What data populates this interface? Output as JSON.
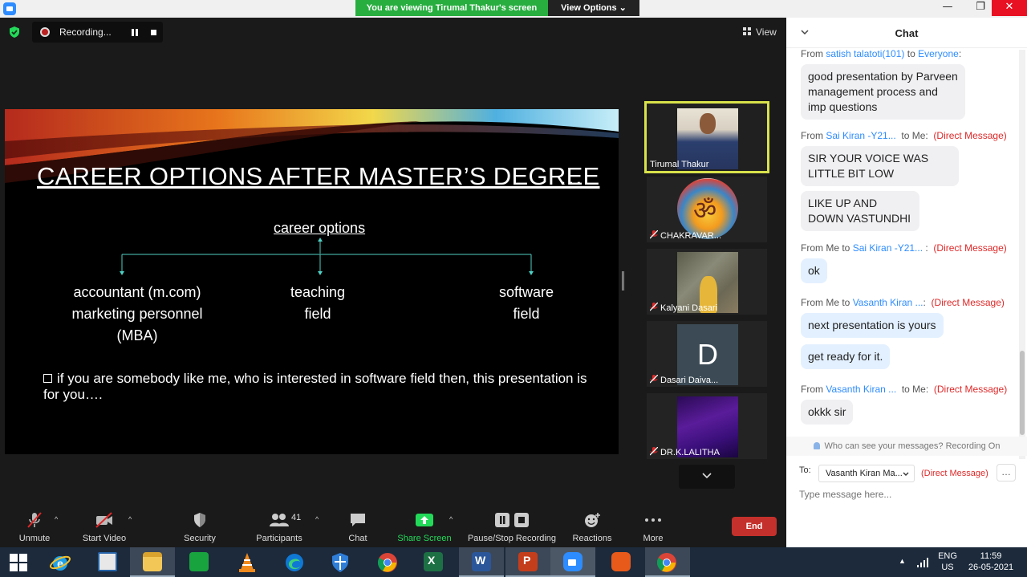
{
  "titlebar": {
    "viewing_banner": "You are viewing Tirumal Thakur's screen",
    "view_options": "View Options ⌄",
    "minimize": "—",
    "maximize": "❐",
    "close": "✕"
  },
  "meeting": {
    "recording_label": "Recording...",
    "view_label": "View"
  },
  "slide": {
    "title": "CAREER OPTIONS AFTER MASTER’S DEGREE",
    "title_suffix": "…",
    "subheading": "career options",
    "option_1": [
      "accountant (m.com)",
      "marketing personnel",
      "(MBA)"
    ],
    "option_2": [
      "teaching",
      "field"
    ],
    "option_3": [
      "software",
      "field"
    ],
    "bullet": "if you are somebody like me, who is interested in software field then, this presentation is for you…."
  },
  "tiles": [
    {
      "name": "Tirumal Thakur",
      "muted": false,
      "active_speaker": true
    },
    {
      "name": "CHAKRAVAR...",
      "muted": true
    },
    {
      "name": "Kalyani Dasari",
      "muted": true
    },
    {
      "name": "Dasari Daiva...",
      "muted": true,
      "initial": "D"
    },
    {
      "name": "DR.K.LALITHA",
      "muted": true
    }
  ],
  "toolbar": {
    "unmute": "Unmute",
    "start_video": "Start Video",
    "security": "Security",
    "participants": "Participants",
    "participants_count": "41",
    "chat": "Chat",
    "share_screen": "Share Screen",
    "pause_stop_recording": "Pause/Stop Recording",
    "reactions": "Reactions",
    "more": "More",
    "end": "End"
  },
  "chat": {
    "title": "Chat",
    "messages": [
      {
        "from_prefix": "From",
        "sender": "satish talatoti(101)",
        "to": "to",
        "recipient": "Everyone",
        "suffix": ":",
        "direct": "",
        "texts": [
          "good presentation by Parveen management process and imp questions"
        ]
      },
      {
        "from_prefix": "From",
        "sender": "Sai Kiran -Y21...",
        "to": "to Me:",
        "recipient": "",
        "suffix": "",
        "direct": "(Direct Message)",
        "texts": [
          "SIR YOUR VOICE WAS LITTLE BIT LOW",
          "LIKE UP AND DOWN VASTUNDHI"
        ]
      },
      {
        "from_prefix": "From Me to",
        "sender": "Sai Kiran -Y21...",
        "to": ":",
        "recipient": "",
        "suffix": "",
        "direct": "(Direct Message)",
        "texts": [
          "ok"
        ]
      },
      {
        "from_prefix": "From Me to",
        "sender": "Vasanth Kiran ...",
        "to": ":",
        "recipient": "",
        "suffix": "",
        "direct": "(Direct Message)",
        "texts": [
          "next presentation is yours",
          "get ready for it."
        ]
      },
      {
        "from_prefix": "From",
        "sender": "Vasanth Kiran ...",
        "to": "to Me:",
        "recipient": "",
        "suffix": "",
        "direct": "(Direct Message)",
        "texts": [
          "okkk sir"
        ]
      }
    ],
    "privacy_note": "Who can see your messages? Recording On",
    "to_label": "To:",
    "to_value": "Vasanth Kiran Ma...",
    "to_direct": "(Direct Message)",
    "more_label": "…",
    "input_placeholder": "Type message here..."
  },
  "taskbar": {
    "lang_line1": "ENG",
    "lang_line2": "US",
    "time": "11:59",
    "date": "26-05-2021"
  },
  "colors": {
    "banner_green": "#27ae3f",
    "end_red": "#c4302b",
    "active_speaker_border": "#d8e24a",
    "chat_sender_blue": "#2d8cff",
    "direct_message_red": "#e02828"
  }
}
